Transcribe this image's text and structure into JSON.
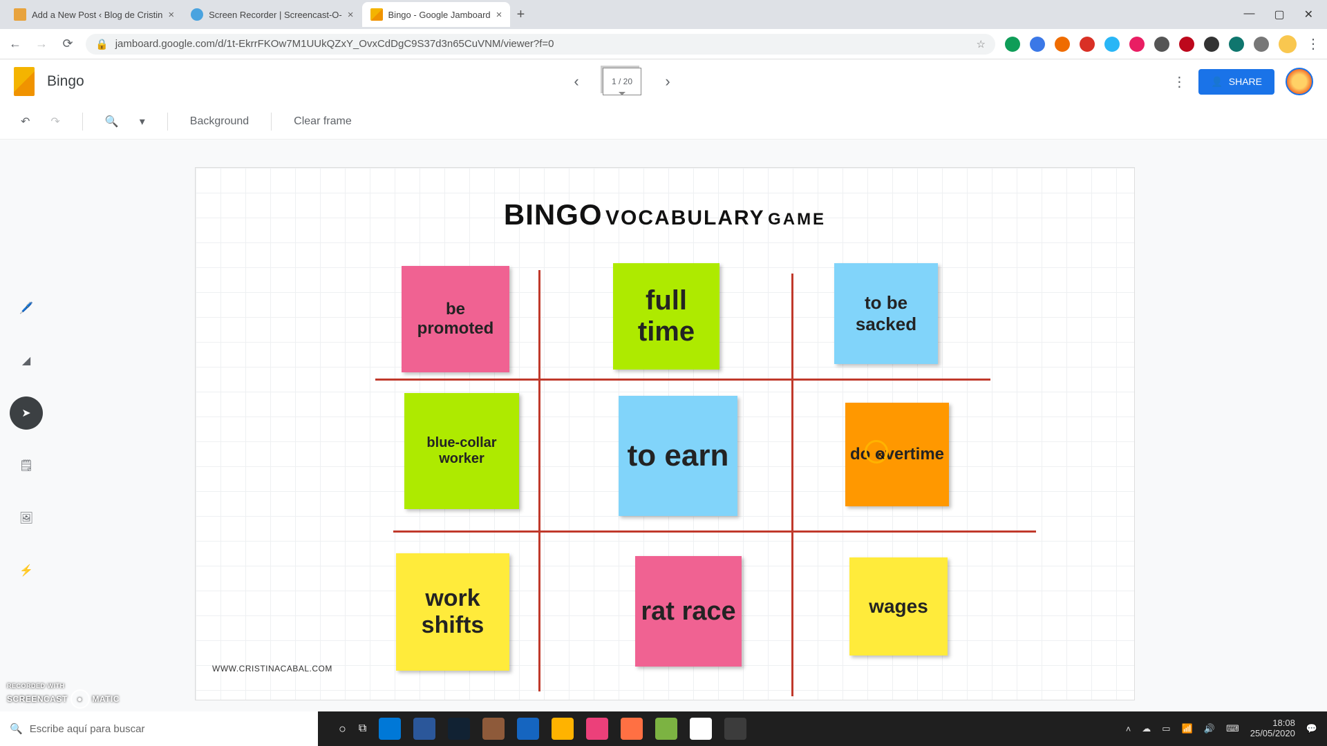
{
  "browser": {
    "tabs": [
      {
        "label": "Add a New Post ‹ Blog de Cristin"
      },
      {
        "label": "Screen Recorder | Screencast-O-"
      },
      {
        "label": "Bingo - Google Jamboard"
      }
    ],
    "url": "jamboard.google.com/d/1t-EkrrFKOw7M1UUkQZxY_OvxCdDgC9S37d3n65CuVNM/viewer?f=0"
  },
  "window": {
    "minimize": "—",
    "maximize": "▢",
    "close": "✕"
  },
  "jamboard": {
    "title": "Bingo",
    "frame_counter": "1 / 20",
    "share": "SHARE",
    "toolbar": {
      "background": "Background",
      "clear": "Clear frame"
    }
  },
  "canvas": {
    "title": {
      "t1": "BINGO",
      "t2": "VOCABULARY",
      "t3": "GAME"
    },
    "stickers": {
      "s1": "be promoted",
      "s2": "full time",
      "s3": "to be sacked",
      "s4": "blue-collar worker",
      "s5": "to earn",
      "s6": "do overtime",
      "s7": "work shifts",
      "s8": "rat race",
      "s9": "wages"
    },
    "credit": "WWW.CRISTINACABAL.COM"
  },
  "taskbar": {
    "search_placeholder": "Escribe aquí para buscar",
    "time": "18:08",
    "date": "25/05/2020"
  },
  "watermark": {
    "line1": "RECORDED WITH",
    "line2": "SCREENCAST",
    "line3": "MATIC"
  }
}
